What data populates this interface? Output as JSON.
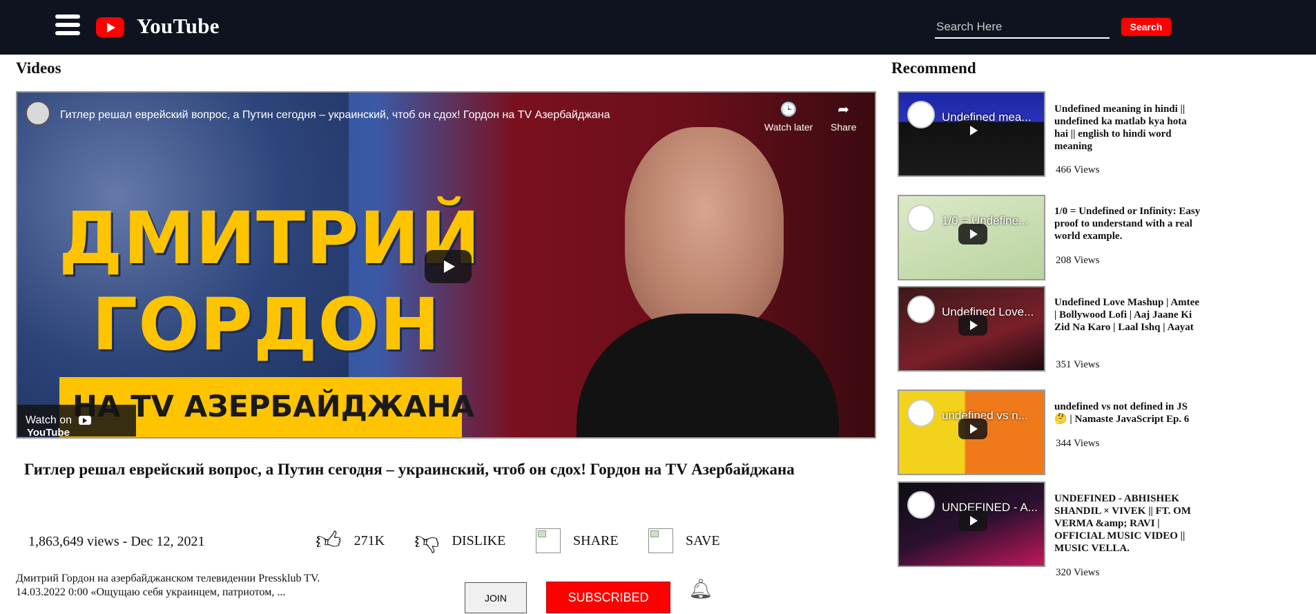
{
  "header": {
    "brand": "YouTube",
    "search_placeholder": "Search Here",
    "search_button": "Search"
  },
  "sections": {
    "videos": "Videos",
    "recommend": "Recommend"
  },
  "player": {
    "overlay_title": "Гитлер решал еврейский вопрос, а Путин сегодня – украинский, чтоб он сдох! Гордон на TV Азербайджана",
    "watch_later": "Watch later",
    "share": "Share",
    "watch_on": "Watch on",
    "watch_on_brand": "YouTube",
    "thumb_line1": "ДМИТРИЙ",
    "thumb_line2": "ГОРДОН",
    "thumb_banner": "НА TV АЗЕРБАЙДЖАНА"
  },
  "video": {
    "title": "Гитлер решал еврейский вопрос, а Путин сегодня – украинский, чтоб он сдох! Гордон на TV Азербайджана",
    "views_date": "1,863,649 views - Dec 12, 2021",
    "likes": "271K",
    "dislike": "DISLIKE",
    "share": "SHARE",
    "save": "SAVE",
    "description_line1": "Дмитрий Гордон на азербайджанском телевидении Pressklub TV.",
    "description_line2": "14.03.2022 0:00 «Ощущаю себя украинцем, патриотом, ...",
    "join": "JOIN",
    "subscribed": "SUBSCRIBED"
  },
  "recommendations": [
    {
      "thumb_title": "Undefined mea...",
      "title": "Undefined meaning in hindi || undefined ka matlab kya hota hai || english to hindi word meaning",
      "views": "466 Views"
    },
    {
      "thumb_title": "1/0 = Undefine...",
      "title": "1/0 = Undefined or Infinity: Easy proof to understand with a real world example.",
      "views": "208 Views"
    },
    {
      "thumb_title": "Undefined Love...",
      "title": "Undefined Love Mashup | Amtee | Bollywood Lofi | Aaj Jaane Ki Zid Na Karo | Laal Ishq | Aayat",
      "views": "351 Views"
    },
    {
      "thumb_title": "undefined vs n...",
      "title": "undefined vs not defined in JS 🤔 | Namaste JavaScript Ep. 6",
      "views": "344 Views"
    },
    {
      "thumb_title": "UNDEFINED - A...",
      "title": "UNDEFINED - ABHISHEK SHANDIL × VIVEK || FT. OM VERMA &amp; RAVI | OFFICIAL MUSIC VIDEO || MUSIC VELLA.",
      "views": "320 Views"
    }
  ]
}
